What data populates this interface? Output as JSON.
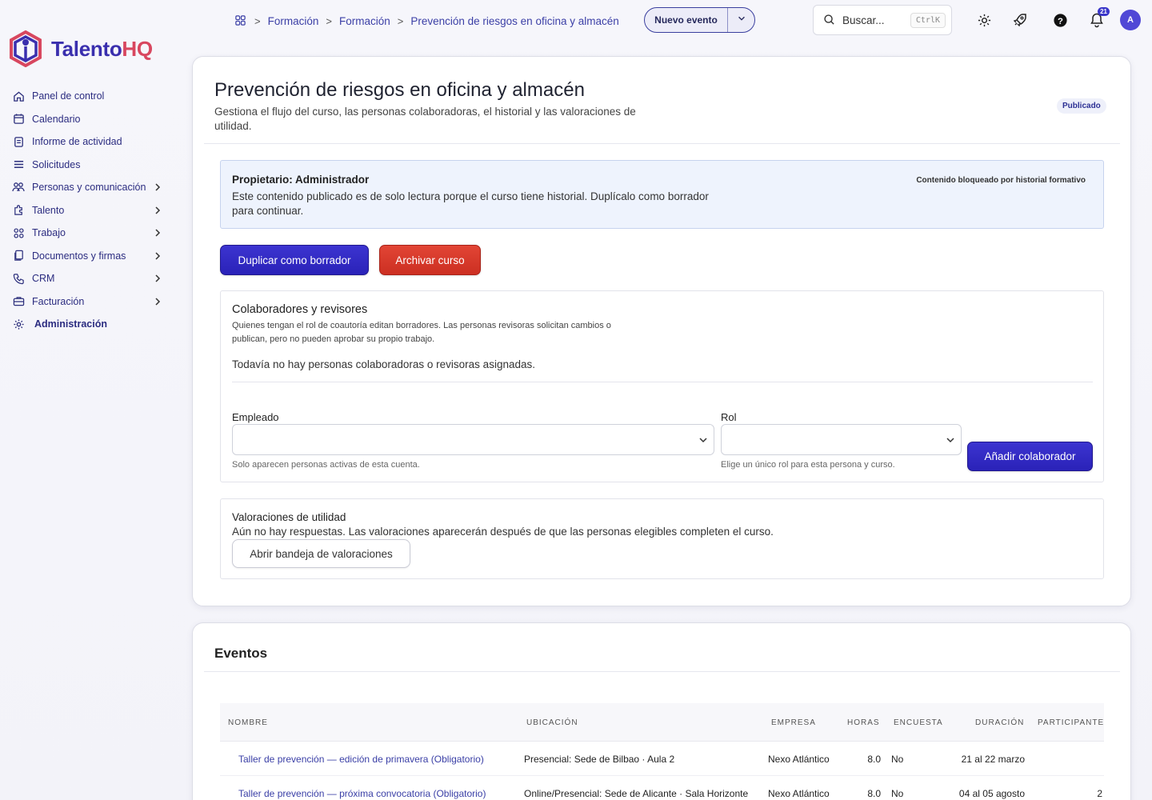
{
  "brand": {
    "name_part1": "Talento",
    "name_part2": "HQ"
  },
  "sidebar": {
    "items": [
      {
        "label": "Panel de control",
        "icon": "home-icon",
        "has_chevron": false
      },
      {
        "label": "Calendario",
        "icon": "calendar-icon",
        "has_chevron": false
      },
      {
        "label": "Informe de actividad",
        "icon": "report-icon",
        "has_chevron": false
      },
      {
        "label": "Solicitudes",
        "icon": "list-icon",
        "has_chevron": false
      },
      {
        "label": "Personas y comunicación",
        "icon": "people-icon",
        "has_chevron": true
      },
      {
        "label": "Talento",
        "icon": "puzzle-icon",
        "has_chevron": true
      },
      {
        "label": "Trabajo",
        "icon": "grid-icon",
        "has_chevron": true
      },
      {
        "label": "Documentos y firmas",
        "icon": "documents-icon",
        "has_chevron": true
      },
      {
        "label": "CRM",
        "icon": "phone-icon",
        "has_chevron": true
      },
      {
        "label": "Facturación",
        "icon": "briefcase-icon",
        "has_chevron": true
      },
      {
        "label": "Administración",
        "icon": "gear-icon",
        "has_chevron": false
      }
    ]
  },
  "topbar": {
    "breadcrumbs": [
      "Formación",
      "Formación",
      "Prevención de riesgos en oficina y almacén"
    ],
    "new_event_label": "Nuevo evento",
    "search_placeholder": "Buscar...",
    "search_shortcut": "CtrlK",
    "notification_count": "21",
    "avatar_initial": "A"
  },
  "course": {
    "title": "Prevención de riesgos en oficina y almacén",
    "subtitle": "Gestiona el flujo del curso, las personas colaboradoras, el historial y las valoraciones de utilidad.",
    "status": "Publicado",
    "notice": {
      "title": "Propietario: Administrador",
      "text": "Este contenido publicado es de solo lectura porque el curso tiene historial. Duplícalo como borrador para continuar.",
      "right_label": "Contenido bloqueado por historial formativo"
    },
    "duplicate_label": "Duplicar como borrador",
    "archive_label": "Archivar curso"
  },
  "collaborators": {
    "title": "Colaboradores y revisores",
    "description": "Quienes tengan el rol de coautoría editan borradores. Las personas revisoras solicitan cambios o publican, pero no pueden aprobar su propio trabajo.",
    "empty_text": "Todavía no hay personas colaboradoras o revisoras asignadas.",
    "employee_label": "Empleado",
    "employee_help": "Solo aparecen personas activas de esta cuenta.",
    "role_label": "Rol",
    "role_help": "Elige un único rol para esta persona y curso.",
    "add_label": "Añadir colaborador"
  },
  "ratings": {
    "title": "Valoraciones de utilidad",
    "text": "Aún no hay respuestas. Las valoraciones aparecerán después de que las personas elegibles completen el curso.",
    "open_label": "Abrir bandeja de valoraciones"
  },
  "events": {
    "title": "Eventos",
    "columns": [
      "NOMBRE",
      "UBICACIÓN",
      "EMPRESA",
      "HORAS",
      "ENCUESTA",
      "DURACIÓN",
      "PARTICIPANTES"
    ],
    "rows": [
      {
        "name": "Taller de prevención — edición de primavera (Obligatorio)",
        "location": "Presencial: Sede de Bilbao · Aula 2",
        "company": "Nexo Atlántico",
        "hours": "8.0",
        "survey": "No",
        "duration": "21 al 22 marzo",
        "participants": ""
      },
      {
        "name": "Taller de prevención — próxima convocatoria (Obligatorio)",
        "location": "Online/Presencial: Sede de Alicante · Sala Horizonte",
        "company": "Nexo Atlántico",
        "hours": "8.0",
        "survey": "No",
        "duration": "04 al 05 agosto",
        "participants": "2"
      }
    ]
  }
}
